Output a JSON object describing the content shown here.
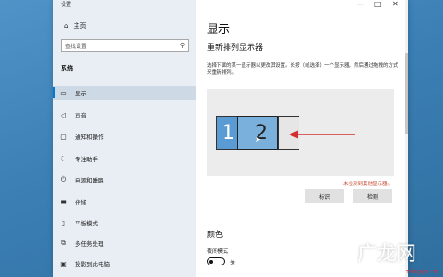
{
  "window": {
    "title": "设置",
    "controls": {
      "minimize": "—",
      "maximize": "□",
      "close": "✕"
    }
  },
  "sidebar": {
    "home": {
      "label": "主页",
      "icon": "home-icon"
    },
    "search": {
      "placeholder": "查找设置",
      "icon": "search-icon"
    },
    "section": "系统",
    "items": [
      {
        "label": "显示",
        "icon": "monitor-icon",
        "active": true
      },
      {
        "label": "声音",
        "icon": "speaker-icon"
      },
      {
        "label": "通知和操作",
        "icon": "notification-icon"
      },
      {
        "label": "专注助手",
        "icon": "moon-icon"
      },
      {
        "label": "电源和睡眠",
        "icon": "power-icon"
      },
      {
        "label": "存储",
        "icon": "storage-icon"
      },
      {
        "label": "平板模式",
        "icon": "tablet-icon"
      },
      {
        "label": "多任务处理",
        "icon": "multitask-icon"
      },
      {
        "label": "投影到此电脑",
        "icon": "project-icon"
      }
    ]
  },
  "main": {
    "title": "显示",
    "rearrange_title": "重新排列显示器",
    "description": "选择下面的某一显示器以更改其设置。长按（或选择）一个显示器，然后通过拖拽的方式来重新排列。",
    "monitors": [
      "1",
      "2"
    ],
    "not_detected": "未检测到其他显示器。",
    "identify_button": "标识",
    "detect_button": "检测",
    "color_title": "颜色",
    "night_mode_label": "夜间模式",
    "night_mode_state": "关"
  },
  "watermark": {
    "text": "广龙网",
    "url": "mingyx.cn"
  },
  "colors": {
    "accent": "#0078d7",
    "arrow": "#d32f2f",
    "notice": "#c23b22"
  }
}
